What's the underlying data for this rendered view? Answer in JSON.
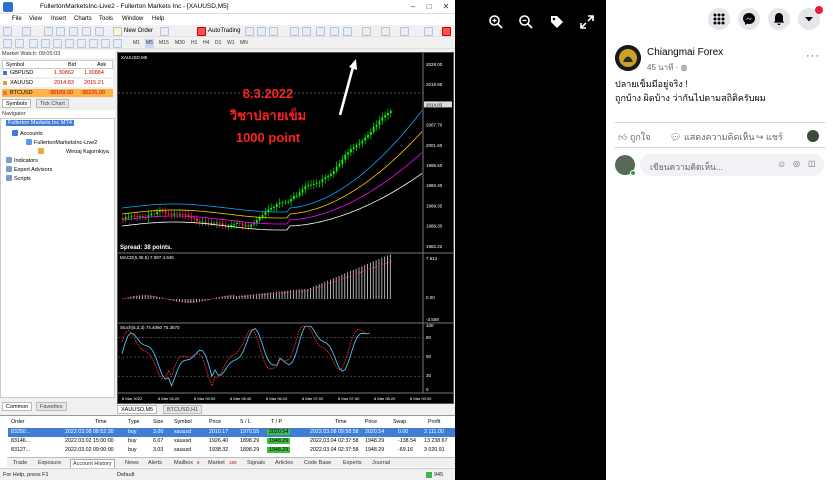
{
  "mt4": {
    "title": "FullertonMarketsInc-Live2 - Fullerton Markets Inc - [XAUUSD,M5]",
    "menu": [
      "File",
      "View",
      "Insert",
      "Charts",
      "Tools",
      "Window",
      "Help"
    ],
    "toolbar": {
      "new_order": "New Order",
      "autotrading": "AutoTrading",
      "timeframes": [
        "M1",
        "M5",
        "M15",
        "M30",
        "H1",
        "H4",
        "D1",
        "W1",
        "MN"
      ]
    },
    "market_watch": {
      "title": "Market Watch: 09:05:03",
      "headers": [
        "Symbol",
        "Bid",
        "Ask"
      ],
      "rows": [
        {
          "symbol": "GBPUSD",
          "bid": "1.30862",
          "ask": "1.30884",
          "flag": "#3f6fd0"
        },
        {
          "symbol": "XAUUSD",
          "bid": "2014.83",
          "ask": "2015.21",
          "flag": "#e0a020"
        },
        {
          "symbol": "BTCUSD",
          "bid": "38189.00",
          "ask": "38226.00",
          "flag": "#e08020"
        }
      ],
      "tabs": [
        "Symbols",
        "Tick Chart"
      ]
    },
    "navigator": {
      "title": "Navigator",
      "items": [
        "Fullerton Markets Inc MT4",
        "Accounts",
        "FullertonMarketsInc-Live2",
        "Wiroaj Kajornkiya",
        "Indicators",
        "Expert Advisors",
        "Scripts"
      ],
      "tabs": [
        "Common",
        "Favorites"
      ]
    },
    "chart": {
      "symbol_label": "XAUUSD,M5",
      "annotation": {
        "line1": "8.3.2022",
        "line2": "วิชาปลายเข็ม",
        "line3": "1000 point",
        "color": "#ff2222"
      },
      "spread_text": "Spread: 38 points.",
      "macd_label": "MACD(5,35,5) 7.087 4.945",
      "stoch_label": "Stoch(5,3,3) 74.4060 75.3570",
      "price_scale": [
        "2028.00",
        "2018.95",
        "2014.83",
        "2007.70",
        "2001.60",
        "1995.50",
        "1992.40",
        "1989.35",
        "1986.30",
        "1982.22"
      ],
      "macd_scale": [
        "7.612",
        "0.00",
        "-3.558"
      ],
      "stoch_scale": [
        "100",
        "80",
        "50",
        "20",
        "0"
      ],
      "time_axis": [
        "8 Mar 2022",
        "8 Mar 04:20",
        "8 Mar 05:00",
        "8 Mar 05:40",
        "8 Mar 06:20",
        "8 Mar 07:00",
        "8 Mar 07:40",
        "8 Mar 08:20",
        "8 Mar 09:00"
      ],
      "tabs": [
        "XAUUSD,M5",
        "BTCUSD,H1"
      ]
    },
    "terminal": {
      "headers": [
        "Order",
        "Time",
        "Type",
        "Size",
        "Symbol",
        "Price",
        "S / L",
        "T / P",
        "Time",
        "Price",
        "Swap",
        "Profit"
      ],
      "rows": [
        [
          "83350...",
          "2022.03.08 08:52:30",
          "buy",
          "3.00",
          "xauusd",
          "2010.17",
          "1970.55",
          "2020.54",
          "2022.03.08 09:58:58",
          "2020.54",
          "0.00",
          "3 111.00"
        ],
        [
          "83146...",
          "2022.03.02 15:00:00",
          "buy",
          "6.07",
          "xauusd",
          "1926.40",
          "1898.29",
          "1948.29",
          "2022.03.04 02:37:58",
          "1948.29",
          "-138.54",
          "13 238.67"
        ],
        [
          "83127...",
          "2022.03.02 09:00:00",
          "buy",
          "3.03",
          "xauusd",
          "1938.32",
          "1898.29",
          "1948.29",
          "2022.03.04 02:37:58",
          "1948.29",
          "-69.16",
          "3 020.91"
        ]
      ],
      "tabs": [
        "Trade",
        "Exposure",
        "Account History",
        "News",
        "Alerts",
        "Mailbox",
        "Market",
        "Signals",
        "Articles",
        "Code Base",
        "Experts",
        "Journal"
      ],
      "mailbox_badge": "6",
      "market_badge": "159",
      "side_label": "Terminal"
    },
    "status": {
      "help": "For Help, press F1",
      "profile": "Default",
      "right": "945"
    }
  },
  "viewer": {
    "icons": [
      "zoom-in-icon",
      "zoom-out-icon",
      "tag-icon",
      "fullscreen-icon"
    ]
  },
  "facebook": {
    "page_name": "Chiangmai Forex",
    "time": "45 นาที · ",
    "post_line1": "ปลายเข็มมีอยู่จริง !",
    "post_line2": "ถูกบ้าง ผิดบ้าง ว่ากันไปตามสถิติครับผม",
    "like": "ถูกใจ",
    "comment": "แสดงความคิดเห็น",
    "share": "แชร์",
    "comment_placeholder": "เขียนความคิดเห็น...",
    "notification_color": "#e41e3f"
  }
}
